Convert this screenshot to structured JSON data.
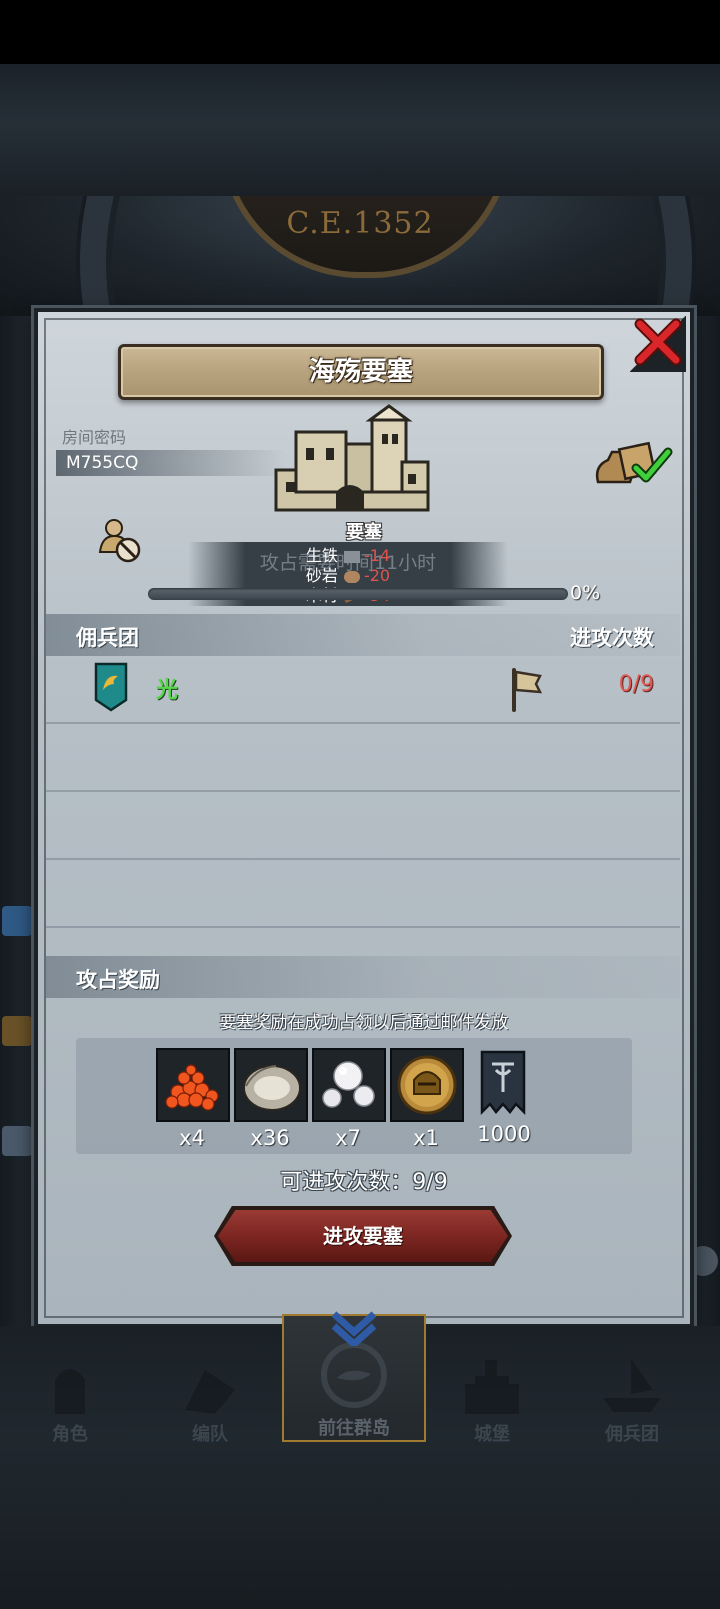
{
  "header": {
    "era": "C.E.1352"
  },
  "modal": {
    "title": "海殇要塞",
    "room_label": "房间密码",
    "room_code": "M755CQ",
    "fortress_label": "要塞",
    "ghost_text": "攻占需要时间11小时",
    "resources": [
      {
        "name": "生铁",
        "value": "-14",
        "icon": "iron-icon"
      },
      {
        "name": "砂岩",
        "value": "-20",
        "icon": "stone-icon"
      },
      {
        "name": "木材",
        "value": "-34",
        "icon": "wood-icon"
      }
    ],
    "progress_percent": "0%",
    "progress_fraction": 0,
    "mercenary_header": "佣兵团",
    "attack_count_header": "进攻次数",
    "guilds": [
      {
        "name": "光",
        "attacks": "0/9"
      }
    ],
    "reward_header": "攻占奖励",
    "reward_note": "要塞奖励在成功占领以后通过邮件发放",
    "rewards": [
      {
        "icon": "roe-icon",
        "qty": "x4"
      },
      {
        "icon": "oyster-icon",
        "qty": "x36"
      },
      {
        "icon": "pearl-icon",
        "qty": "x7"
      },
      {
        "icon": "helmet-coin-icon",
        "qty": "x1"
      },
      {
        "icon": "guild-banner-icon",
        "qty": "1000"
      }
    ],
    "attacks_available": "可进攻次数：9/9",
    "attack_button": "进攻要塞"
  },
  "nav": {
    "items": [
      {
        "label": "角色",
        "icon": "knight-icon"
      },
      {
        "label": "编队",
        "icon": "formation-icon"
      },
      {
        "label": "前往群岛",
        "icon": "islands-icon",
        "active": true
      },
      {
        "label": "城堡",
        "icon": "castle-icon"
      },
      {
        "label": "佣兵团",
        "icon": "ship-icon"
      }
    ]
  },
  "colors": {
    "negative": "#e05a52",
    "guild_green": "#56d64a",
    "button_red": "#7a2420",
    "accent_gold": "#a07a2e"
  }
}
